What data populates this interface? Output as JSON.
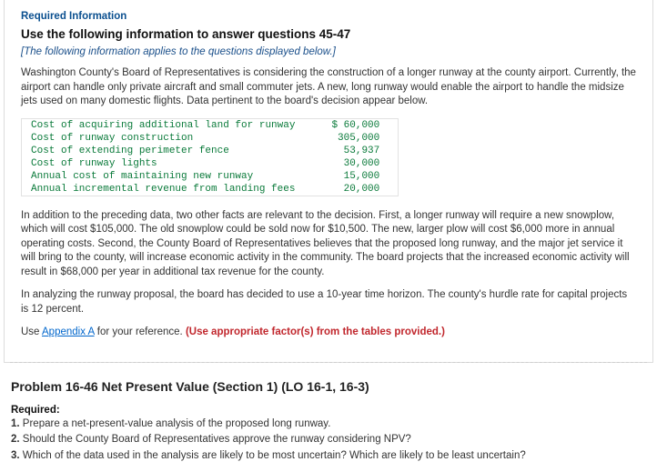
{
  "card": {
    "required_info": "Required Information",
    "use_heading": "Use the following information to answer questions 45-47",
    "applies": "[The following information applies to the questions displayed below.]",
    "intro": "Washington County's Board of Representatives is considering the construction of a longer runway at the county airport. Currently, the airport can handle only private aircraft and small commuter jets. A new, long runway would enable the airport to handle the midsize jets used on many domestic flights. Data pertinent to the board's decision appear below.",
    "table": {
      "rows": [
        {
          "label": "Cost of acquiring additional land for runway",
          "value": "$ 60,000"
        },
        {
          "label": "Cost of runway construction",
          "value": "305,000"
        },
        {
          "label": "Cost of extending perimeter fence",
          "value": "53,937"
        },
        {
          "label": "Cost of runway lights",
          "value": "30,000"
        },
        {
          "label": "Annual cost of maintaining new runway",
          "value": "15,000"
        },
        {
          "label": "Annual incremental revenue from landing fees",
          "value": "20,000"
        }
      ]
    },
    "para2": "In addition to the preceding data, two other facts are relevant to the decision. First, a longer runway will require a new snowplow, which will cost $105,000. The old snowplow could be sold now for $10,500. The new, larger plow will cost $6,000 more in annual operating costs. Second, the County Board of Representatives believes that the proposed long runway, and the major jet service it will bring to the county, will increase economic activity in the community. The board projects that the increased economic activity will result in $68,000 per year in additional tax revenue for the county.",
    "para3": "In analyzing the runway proposal, the board has decided to use a 10-year time horizon. The county's hurdle rate for capital projects is 12 percent.",
    "use_text_pre": "Use ",
    "appendix_link": "Appendix A",
    "use_text_post": " for your reference. ",
    "use_factor": "(Use appropriate factor(s) from the tables provided.)"
  },
  "problem": {
    "title": "Problem 16-46 Net Present Value (Section 1) (LO 16-1, 16-3)",
    "required_label": "Required:",
    "items": [
      {
        "num": "1.",
        "text": "Prepare a net-present-value analysis of the proposed long runway."
      },
      {
        "num": "2.",
        "text": "Should the County Board of Representatives approve the runway considering NPV?"
      },
      {
        "num": "3.",
        "text": "Which of the data used in the analysis are likely to be most uncertain? Which are likely to be least uncertain?"
      }
    ]
  }
}
